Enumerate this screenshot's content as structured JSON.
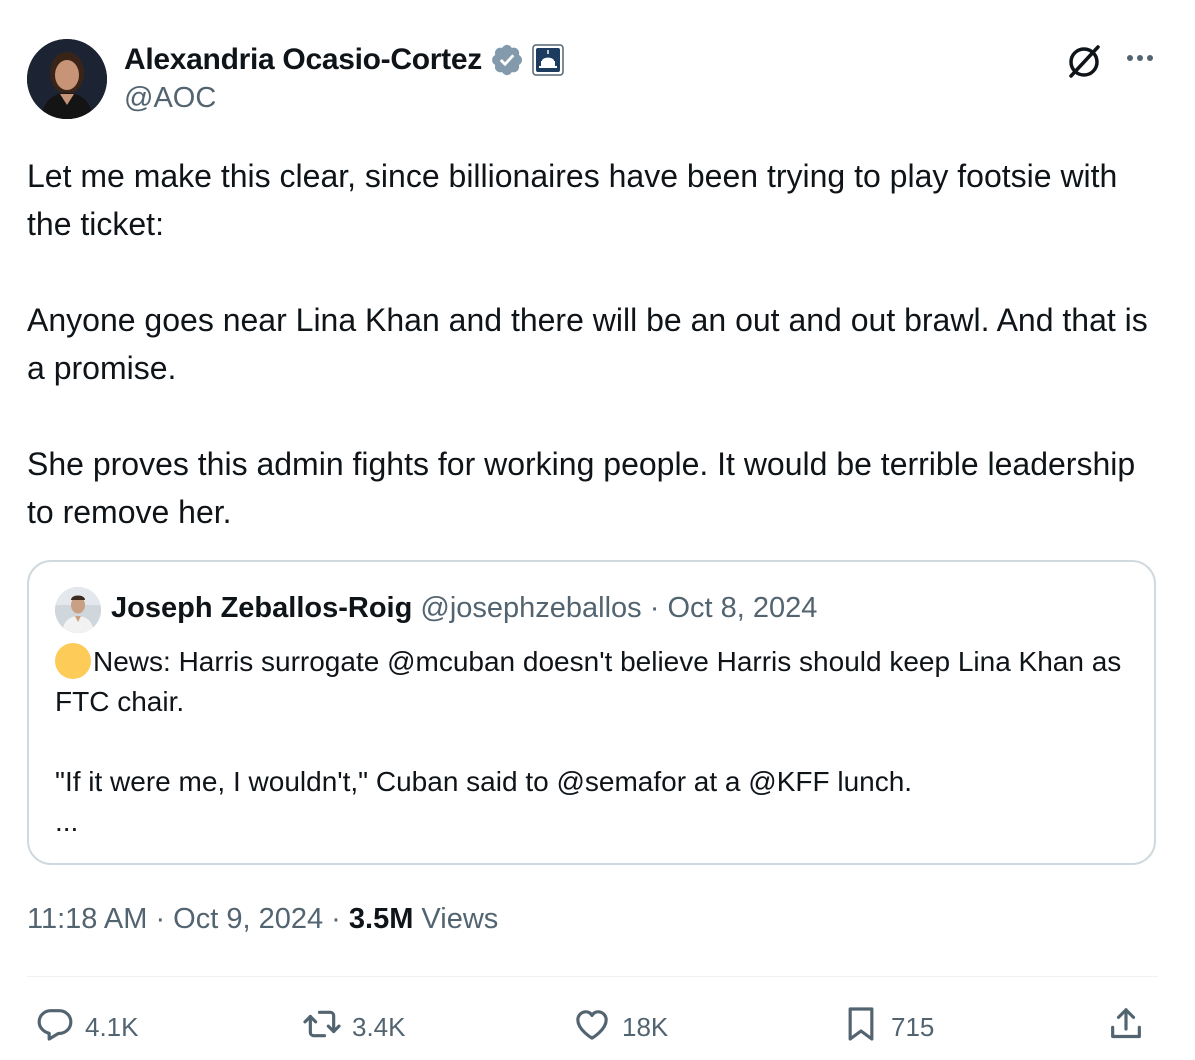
{
  "author": {
    "display_name": "Alexandria Ocasio-Cortez",
    "handle": "@AOC"
  },
  "tweet": {
    "paragraphs": [
      "Let me make this clear, since billionaires have been trying to play footsie with the ticket:",
      "Anyone goes near Lina Khan and there will be an out and out brawl. And that is a promise.",
      "She proves this admin fights for working people. It would be terrible leadership to remove her."
    ]
  },
  "quote": {
    "display_name": "Joseph Zeballos-Roig",
    "handle": "@josephzeballos",
    "separator": " · ",
    "date": "Oct 8, 2024",
    "line1": "News: Harris surrogate @mcuban doesn't believe Harris should keep Lina Khan as FTC chair.",
    "line2": "\"If it were me, I wouldn't,\" Cuban said to @semafor at a @KFF lunch.",
    "ellipsis": "..."
  },
  "meta": {
    "time": "11:18 AM",
    "separator": " · ",
    "date": "Oct 9, 2024",
    "separator2": " · ",
    "views_count": "3.5M",
    "views_label": " Views"
  },
  "actions": {
    "replies": "4.1K",
    "retweets": "3.4K",
    "likes": "18K",
    "bookmarks": "715"
  },
  "icons": {
    "verified": "verified-badge-icon",
    "government": "government-affiliation-icon",
    "grok": "grok-icon",
    "more": "more-icon",
    "reply": "reply-icon",
    "retweet": "retweet-icon",
    "like": "heart-icon",
    "bookmark": "bookmark-icon",
    "share": "share-icon"
  },
  "colors": {
    "text": "#0f1419",
    "secondary": "#536471",
    "border": "#cfd9de",
    "verified_badge": "#829aab",
    "emoji": "#fdcb58"
  }
}
